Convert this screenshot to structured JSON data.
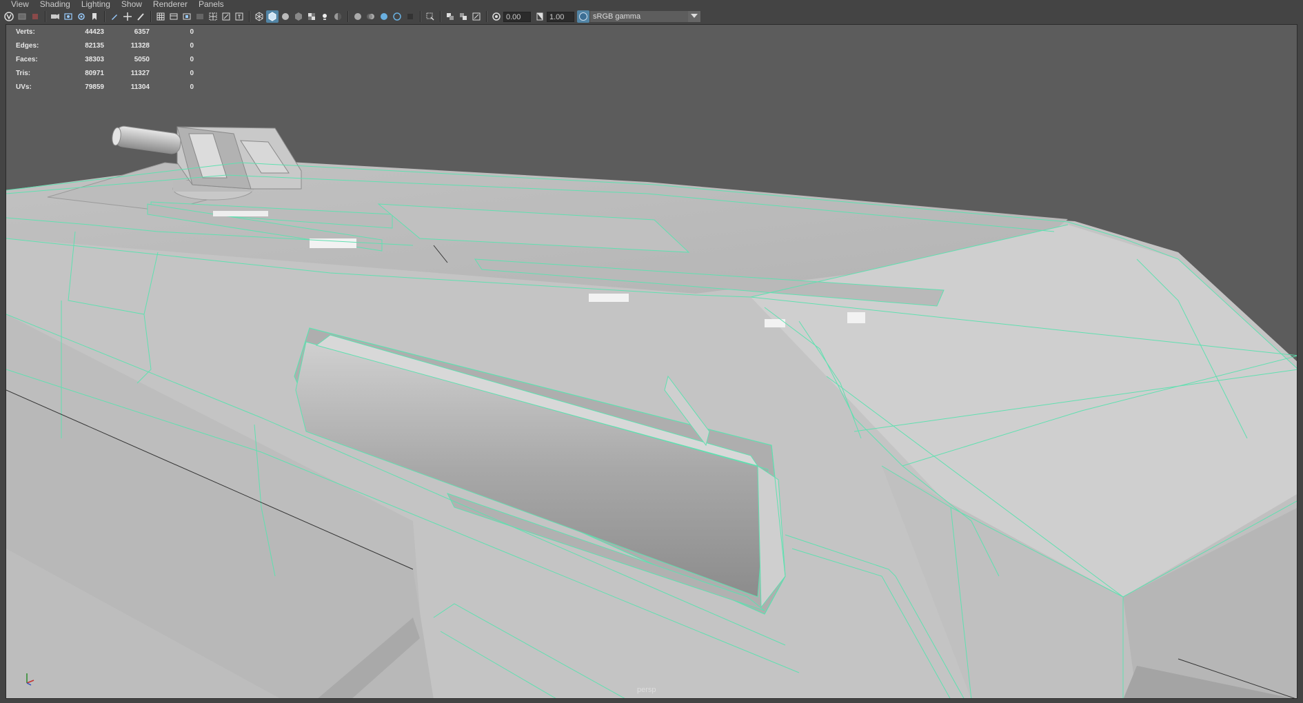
{
  "menu": [
    "View",
    "Shading",
    "Lighting",
    "Show",
    "Renderer",
    "Panels"
  ],
  "toolbar": {
    "exposure_value": "0.00",
    "gamma_value": "1.00",
    "color_space": "sRGB gamma",
    "icons": [
      "select-camera-icon",
      "camera-attributes-icon",
      "bookmarks-icon",
      "image-plane-icon",
      "2d-pan-icon",
      "grease-pencil-icon",
      "grid-icon",
      "film-gate-icon",
      "resolution-gate-icon",
      "gate-mask-icon",
      "field-chart-icon",
      "safe-action-icon",
      "safe-title-icon",
      "wireframe-icon",
      "smooth-shade-icon",
      "use-default-material-icon",
      "wireframe-on-shaded-icon",
      "textured-icon",
      "use-all-lights-icon",
      "shadows-icon",
      "screen-space-ao-icon",
      "motion-blur-icon",
      "multisample-aa-icon",
      "depth-of-field-icon",
      "isolate-select-icon",
      "xray-icon",
      "xray-joints-icon",
      "xray-active-components-icon",
      "exposure-icon",
      "gamma-icon",
      "color-management-icon"
    ],
    "active_icons": [
      "wireframe-on-shaded-icon"
    ]
  },
  "hud": {
    "rows": [
      {
        "label": "Verts:",
        "total": "44423",
        "selected": "6357",
        "extra": "0"
      },
      {
        "label": "Edges:",
        "total": "82135",
        "selected": "11328",
        "extra": "0"
      },
      {
        "label": "Faces:",
        "total": "38303",
        "selected": "5050",
        "extra": "0"
      },
      {
        "label": "Tris:",
        "total": "80971",
        "selected": "11327",
        "extra": "0"
      },
      {
        "label": "UVs:",
        "total": "79859",
        "selected": "11304",
        "extra": "0"
      }
    ]
  },
  "viewport": {
    "camera_name": "persp",
    "background_color": "#5c5c5c",
    "wire_color": "#5fe0b0",
    "surface_color": "#c4c4c4"
  }
}
